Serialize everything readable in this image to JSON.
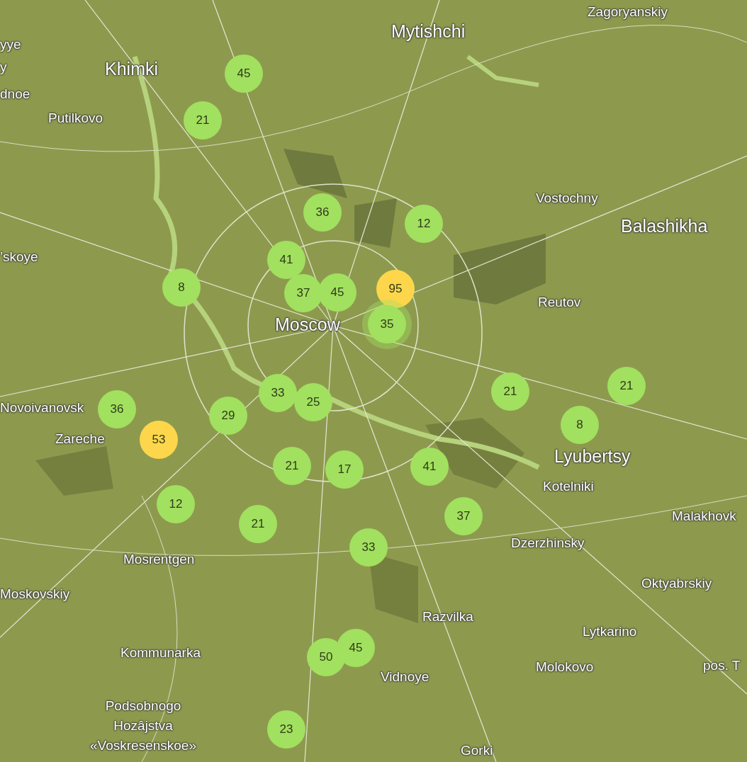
{
  "places": [
    {
      "name": "yye",
      "kind": "town"
    },
    {
      "name": "y",
      "kind": "town"
    },
    {
      "name": "dnoe",
      "kind": "town"
    },
    {
      "name": "Khimki",
      "kind": "city"
    },
    {
      "name": "Putilkovo",
      "kind": "town"
    },
    {
      "name": "Mytishchi",
      "kind": "city"
    },
    {
      "name": "Zagoryanskiy",
      "kind": "town"
    },
    {
      "name": "Vostochny",
      "kind": "town"
    },
    {
      "name": "Balashikha",
      "kind": "city"
    },
    {
      "name": "’skoye",
      "kind": "town"
    },
    {
      "name": "Reutov",
      "kind": "town"
    },
    {
      "name": "Moscow",
      "kind": "city"
    },
    {
      "name": "Novoivanovsk",
      "kind": "town"
    },
    {
      "name": "Zareche",
      "kind": "town"
    },
    {
      "name": "Lyubertsy",
      "kind": "city"
    },
    {
      "name": "Kotelniki",
      "kind": "town"
    },
    {
      "name": "Malakhovk",
      "kind": "town"
    },
    {
      "name": "Dzerzhinsky",
      "kind": "town"
    },
    {
      "name": "Mosrentgen",
      "kind": "town"
    },
    {
      "name": "Moskovskiy",
      "kind": "town"
    },
    {
      "name": "Oktyabrskiy",
      "kind": "town"
    },
    {
      "name": "Razvilka",
      "kind": "town"
    },
    {
      "name": "Lytkarino",
      "kind": "town"
    },
    {
      "name": "Kommunarka",
      "kind": "town"
    },
    {
      "name": "Molokovo",
      "kind": "town"
    },
    {
      "name": "pos. T",
      "kind": "town"
    },
    {
      "name": "Vidnoye",
      "kind": "town"
    },
    {
      "name": "Podsobnogo\nHozâjstva\n«Voskresenskoe»",
      "kind": "town"
    },
    {
      "name": "Gorki",
      "kind": "town"
    }
  ],
  "markers": [
    {
      "value": "45",
      "color": "#a2e05f",
      "selected": false
    },
    {
      "value": "21",
      "color": "#a2e05f",
      "selected": false
    },
    {
      "value": "36",
      "color": "#a2e05f",
      "selected": false
    },
    {
      "value": "12",
      "color": "#a2e05f",
      "selected": false
    },
    {
      "value": "41",
      "color": "#a2e05f",
      "selected": false
    },
    {
      "value": "8",
      "color": "#a2e05f",
      "selected": false
    },
    {
      "value": "45",
      "color": "#a2e05f",
      "selected": false
    },
    {
      "value": "95",
      "color": "#fdd64b",
      "selected": false
    },
    {
      "value": "37",
      "color": "#a2e05f",
      "selected": false
    },
    {
      "value": "35",
      "color": "#a2e05f",
      "selected": true
    },
    {
      "value": "21",
      "color": "#a2e05f",
      "selected": false
    },
    {
      "value": "21",
      "color": "#a2e05f",
      "selected": false
    },
    {
      "value": "33",
      "color": "#a2e05f",
      "selected": false
    },
    {
      "value": "25",
      "color": "#a2e05f",
      "selected": false
    },
    {
      "value": "36",
      "color": "#a2e05f",
      "selected": false
    },
    {
      "value": "29",
      "color": "#a2e05f",
      "selected": false
    },
    {
      "value": "53",
      "color": "#fdd64b",
      "selected": false
    },
    {
      "value": "21",
      "color": "#a2e05f",
      "selected": false
    },
    {
      "value": "17",
      "color": "#a2e05f",
      "selected": false
    },
    {
      "value": "41",
      "color": "#a2e05f",
      "selected": false
    },
    {
      "value": "8",
      "color": "#a2e05f",
      "selected": false
    },
    {
      "value": "12",
      "color": "#a2e05f",
      "selected": false
    },
    {
      "value": "21",
      "color": "#a2e05f",
      "selected": false
    },
    {
      "value": "37",
      "color": "#a2e05f",
      "selected": false
    },
    {
      "value": "33",
      "color": "#a2e05f",
      "selected": false
    },
    {
      "value": "45",
      "color": "#a2e05f",
      "selected": false
    },
    {
      "value": "50",
      "color": "#a2e05f",
      "selected": false
    },
    {
      "value": "23",
      "color": "#a2e05f",
      "selected": false
    }
  ]
}
